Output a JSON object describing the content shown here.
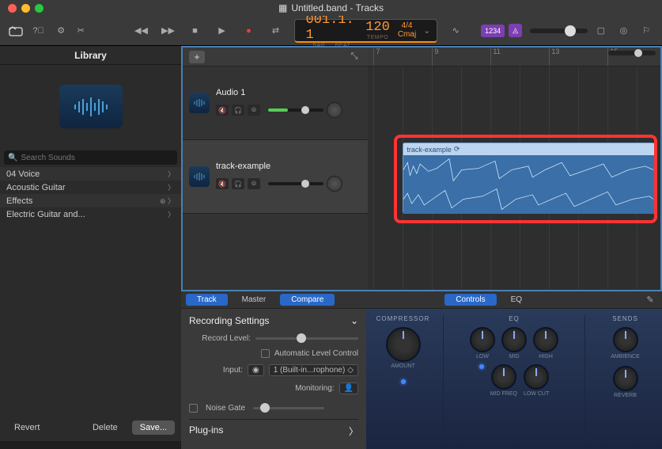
{
  "window": {
    "title": "Untitled.band - Tracks"
  },
  "lcd": {
    "bar_beat": "001.1. 1",
    "bar_lbl": "BAR",
    "beat_lbl": "BEAT",
    "tempo": "120",
    "tempo_lbl": "TEMPO",
    "sig": "4/4",
    "key": "Cmaj"
  },
  "toolbar": {
    "count_in": "1234"
  },
  "library": {
    "title": "Library",
    "search_placeholder": "Search Sounds",
    "items": [
      {
        "label": "04 Voice"
      },
      {
        "label": "Acoustic Guitar"
      },
      {
        "label": "Effects",
        "extra": true
      },
      {
        "label": "Electric Guitar and..."
      }
    ],
    "revert": "Revert",
    "delete": "Delete",
    "save": "Save..."
  },
  "ruler": {
    "marks": [
      "7",
      "9",
      "11",
      "13",
      "15"
    ]
  },
  "tracks": [
    {
      "name": "Audio 1"
    },
    {
      "name": "track-example"
    }
  ],
  "region": {
    "name": "track-example"
  },
  "tabs": {
    "track": "Track",
    "master": "Master",
    "compare": "Compare",
    "controls": "Controls",
    "eq": "EQ"
  },
  "settings": {
    "header": "Recording Settings",
    "record_level": "Record Level:",
    "auto_level": "Automatic Level Control",
    "input": "Input:",
    "input_val": "1 (Built-in...rophone)",
    "monitoring": "Monitoring:",
    "noise_gate": "Noise Gate",
    "plugins": "Plug-ins"
  },
  "fx": {
    "compressor": "COMPRESSOR",
    "amount": "AMOUNT",
    "eq": "EQ",
    "low": "LOW",
    "mid": "MID",
    "high": "HIGH",
    "mid_freq": "MID FREQ",
    "low_cut": "LOW CUT",
    "sends": "SENDS",
    "ambience": "AMBIENCE",
    "reverb": "REVERB"
  }
}
